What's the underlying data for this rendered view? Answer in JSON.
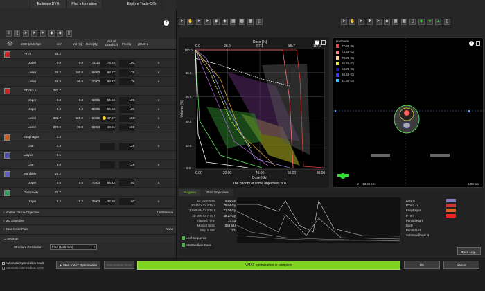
{
  "left_tabs": [
    "",
    "Estimate DVH",
    "Plan Information",
    "Explore Trade-Offs"
  ],
  "help_label": "?",
  "table_headers": [
    "EUD gEUD bpe",
    "cm³",
    "Vol [%]",
    "Dose[Gy]",
    "Actual Dose[Gy]",
    "Priority",
    "gEUD a"
  ],
  "rows": [
    {
      "kind": "struct",
      "color": "#cc2222",
      "name": "PTV I",
      "cm3": "36.2",
      "vol": "",
      "dose": "",
      "actual": "",
      "priority": "",
      "geud": ""
    },
    {
      "kind": "obj",
      "name": "Upper",
      "cm3": "0.0",
      "vol": "0.0",
      "dose": "72.10",
      "actual": "75.84",
      "priority": "150",
      "geud": "x"
    },
    {
      "kind": "obj",
      "name": "Lower",
      "cm3": "36.2",
      "vol": "100.0",
      "dose": "68.60",
      "actual": "68.27",
      "priority": "175",
      "geud": "x"
    },
    {
      "kind": "obj",
      "name": "Lower",
      "cm3": "35.9",
      "vol": "99.0",
      "dose": "70.00",
      "actual": "68.27",
      "priority": "175",
      "geud": "x"
    },
    {
      "kind": "struct",
      "color": "#cc2222",
      "name": "PTV II - I",
      "cm3": "382.7",
      "vol": "",
      "dose": "",
      "actual": "",
      "priority": "",
      "geud": ""
    },
    {
      "kind": "obj",
      "name": "Upper",
      "cm3": "0.0",
      "vol": "0.0",
      "dose": "53.56",
      "actual": "64.56",
      "priority": "125",
      "geud": "x"
    },
    {
      "kind": "obj",
      "name": "Upper",
      "cm3": "0.0",
      "vol": "0.0",
      "dose": "53.56",
      "actual": "64.56",
      "priority": "125",
      "geud": "x"
    },
    {
      "kind": "obj",
      "name": "Lower",
      "cm3": "382.7",
      "vol": "100.0",
      "dose": "50.96",
      "actual": "47.97",
      "priority": "150",
      "geud": "x",
      "warn": true
    },
    {
      "kind": "obj",
      "name": "Lower",
      "cm3": "378.9",
      "vol": "99.0",
      "dose": "52.00",
      "actual": "48.91",
      "priority": "150",
      "geud": "x"
    },
    {
      "kind": "struct",
      "color": "#d06020",
      "name": "Esophagus",
      "cm3": "1.3",
      "vol": "",
      "dose": "",
      "actual": "",
      "priority": "",
      "geud": ""
    },
    {
      "kind": "obj",
      "name": "Line",
      "cm3": "1.3",
      "vol": "",
      "dose": "",
      "actual": "",
      "priority": "125",
      "geud": "x"
    },
    {
      "kind": "struct",
      "color": "#4a4ab0",
      "name": "Larynx",
      "cm3": "8.1",
      "vol": "",
      "dose": "",
      "actual": "",
      "priority": "",
      "geud": ""
    },
    {
      "kind": "obj",
      "name": "Line",
      "cm3": "8.0",
      "vol": "",
      "dose": "",
      "actual": "",
      "priority": "125",
      "geud": "x"
    },
    {
      "kind": "struct",
      "color": "#6060c0",
      "name": "Mandible",
      "cm3": "20.2",
      "vol": "",
      "dose": "",
      "actual": "",
      "priority": "",
      "geud": ""
    },
    {
      "kind": "obj",
      "name": "Upper",
      "cm3": "0.0",
      "vol": "0.0",
      "dose": "70.00",
      "actual": "55.42",
      "priority": "50",
      "geud": "x"
    },
    {
      "kind": "struct",
      "color": "#30a060",
      "name": "Oral cavity",
      "cm3": "32.7",
      "vol": "",
      "dose": "",
      "actual": "",
      "priority": "",
      "geud": ""
    },
    {
      "kind": "obj",
      "name": "Upper",
      "cm3": "5.2",
      "vol": "16.2",
      "dose": "35.00",
      "actual": "32.96",
      "priority": "50",
      "geud": "x"
    }
  ],
  "sections": {
    "nto": {
      "label": "Normal Tissue Objective",
      "value": "120/Manual"
    },
    "mu": {
      "label": "MU Objective"
    },
    "base": {
      "label": "Base Dose Plan",
      "value": "None"
    },
    "settings": {
      "label": "Settings"
    }
  },
  "structure_resolution": {
    "label": "Structure Resolution",
    "value": "Fine (1.25 mm)"
  },
  "dvh": {
    "top_axis_label": "Dose [%]",
    "top_ticks": [
      "0.0",
      "28.6",
      "57.1",
      "85.7",
      "114.3"
    ],
    "bottom_axis_label": "Dose [Gy]",
    "bottom_ticks": [
      "0.00",
      "20.00",
      "40.00",
      "60.00",
      "80.00"
    ],
    "y_axis_label": "Volume [%]",
    "y_ticks": [
      "100.0",
      "80.0",
      "60.0",
      "40.0",
      "20.0",
      "0.0"
    ],
    "message": "The priority of some objectives is 0."
  },
  "isodoses": {
    "title": "Isodoses",
    "items": [
      {
        "label": "77.00 Gy",
        "color": "#e04040"
      },
      {
        "label": "73.50 Gy",
        "color": "#ff8080"
      },
      {
        "label": "70.00 Gy",
        "color": "#ffd0a0"
      },
      {
        "label": "66.50 Gy",
        "color": "#f0f040"
      },
      {
        "label": "63.00 Gy",
        "color": "#2020a0"
      },
      {
        "label": "59.50 Gy",
        "color": "#4040ff"
      },
      {
        "label": "51.30 Gy",
        "color": "#40c0ff"
      }
    ],
    "z_label": "Z : -13.95 cm",
    "scale_label": "5.00 cm"
  },
  "bottom_tabs": [
    "Progress",
    "Plan Objectives"
  ],
  "stats": [
    {
      "label": "3D Dose Max",
      "value": "75.90 Gy"
    },
    {
      "label": "3D MAX for PTV I",
      "value": "75.84 Gy"
    },
    {
      "label": "3D MEAN for PTV I",
      "value": "71.34 Gy"
    },
    {
      "label": "3D MIN for PTV I",
      "value": "68.27 Gy"
    },
    {
      "label": "Elapsed Time",
      "value": "27:53"
    },
    {
      "label": "Monitor Units",
      "value": "834 MU"
    },
    {
      "label": "Step in MR",
      "value": "1/1"
    }
  ],
  "checks": {
    "leaf": "Leaf Sequence",
    "intermediate": "Intermediate Dose"
  },
  "progress_legend": [
    {
      "label": "Larynx",
      "color": "#8080c0"
    },
    {
      "label": "PTV II - I",
      "color": "#cc3333"
    },
    {
      "label": "Esophagus",
      "color": "#e06020"
    },
    {
      "label": "PTV I",
      "color": "#ee2222"
    },
    {
      "label": "Parotid Right",
      "color": ""
    },
    {
      "label": "Body",
      "color": ""
    },
    {
      "label": "Parotid Left",
      "color": ""
    },
    {
      "label": "Submandibular R",
      "color": ""
    }
  ],
  "open_log": "Open Log...",
  "footer": {
    "auto_opt": "Automatic Optimization Mode",
    "auto_int": "Automatic Intermediate Dose",
    "start": "Start VMAT Optimization",
    "intermediate": "Intermediate Dose",
    "status": "VMAT optimization is complete",
    "ok": "OK",
    "cancel": "Cancel",
    "status_color": "#7fd321"
  }
}
